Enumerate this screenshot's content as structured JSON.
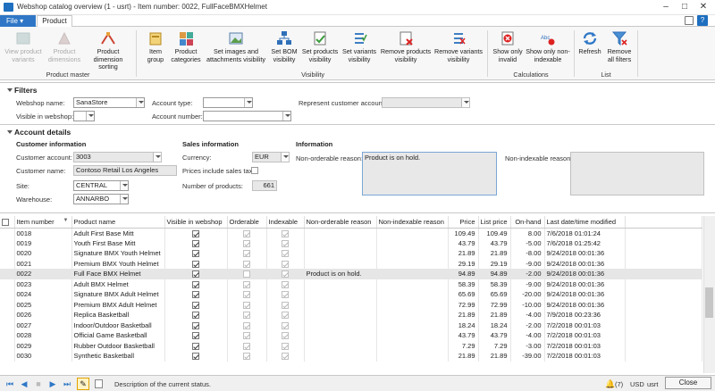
{
  "window": {
    "title": "Webshop catalog overview (1 - usrt) - Item number: 0022, FullFaceBMXHelmet"
  },
  "menu": {
    "file": "File",
    "file_arrow": "▾",
    "product_tab": "Product"
  },
  "ribbon": {
    "product_master": {
      "label": "Product master",
      "buttons": [
        "View product variants",
        "Product dimensions",
        "Product dimension sorting"
      ]
    },
    "main": {
      "buttons": [
        "Item group",
        "Product categories",
        "Set images and attachments visibility",
        "Set BOM visibility",
        "Set products visibility",
        "Set variants visibility",
        "Remove products visibility",
        "Remove variants visibility"
      ],
      "group_label": "Visibility"
    },
    "calculations": {
      "label": "Calculations",
      "buttons": [
        "Show only invalid",
        "Show only non-indexable"
      ]
    },
    "list": {
      "label": "List",
      "buttons": [
        "Refresh",
        "Remove all filters"
      ]
    }
  },
  "filters": {
    "title": "Filters",
    "webshop_name_label": "Webshop name:",
    "webshop_name": "SanaStore",
    "visible_label": "Visible in webshop:",
    "account_type_label": "Account type:",
    "account_number_label": "Account number:",
    "represent_label": "Represent customer account:"
  },
  "account": {
    "title": "Account details",
    "customer_info": "Customer information",
    "customer_account_label": "Customer account:",
    "customer_account": "3003",
    "customer_name_label": "Customer name:",
    "customer_name": "Contoso Retail Los Angeles",
    "site_label": "Site:",
    "site": "CENTRAL",
    "warehouse_label": "Warehouse:",
    "warehouse": "ANNARBO",
    "sales_info": "Sales information",
    "currency_label": "Currency:",
    "currency": "EUR",
    "prices_tax_label": "Prices include sales tax:",
    "num_products_label": "Number of products:",
    "num_products": "661",
    "information": "Information",
    "non_orderable_label": "Non-orderable reason:",
    "non_orderable": "Product is on hold.",
    "non_indexable_label": "Non-indexable reason:"
  },
  "grid": {
    "columns": [
      "Item number",
      "Product name",
      "Visible in webshop",
      "Orderable",
      "Indexable",
      "Non-orderable reason",
      "Non-indexable reason",
      "Price",
      "List price",
      "On-hand",
      "Last date/time modified"
    ],
    "sort_arrow": "▼",
    "rows": [
      {
        "item": "0018",
        "name": "Adult First Base Mitt",
        "visible": true,
        "orderable": true,
        "indexable": true,
        "reason": "",
        "price": "109.49",
        "list": "109.49",
        "onhand": "8.00",
        "date": "7/6/2018 01:01:24"
      },
      {
        "item": "0019",
        "name": "Youth First Base Mitt",
        "visible": true,
        "orderable": true,
        "indexable": true,
        "reason": "",
        "price": "43.79",
        "list": "43.79",
        "onhand": "-5.00",
        "date": "7/6/2018 01:25:42"
      },
      {
        "item": "0020",
        "name": "Signature BMX Youth Helmet",
        "visible": true,
        "orderable": true,
        "indexable": true,
        "reason": "",
        "price": "21.89",
        "list": "21.89",
        "onhand": "-8.00",
        "date": "9/24/2018 00:01:36"
      },
      {
        "item": "0021",
        "name": "Premium BMX Youth Helmet",
        "visible": true,
        "orderable": true,
        "indexable": true,
        "reason": "",
        "price": "29.19",
        "list": "29.19",
        "onhand": "-9.00",
        "date": "9/24/2018 00:01:36"
      },
      {
        "item": "0022",
        "name": "Full Face BMX Helmet",
        "visible": true,
        "orderable": false,
        "indexable": true,
        "reason": "Product is on hold.",
        "price": "94.89",
        "list": "94.89",
        "onhand": "-2.00",
        "date": "9/24/2018 00:01:36",
        "selected": true
      },
      {
        "item": "0023",
        "name": "Adult BMX Helmet",
        "visible": true,
        "orderable": true,
        "indexable": true,
        "reason": "",
        "price": "58.39",
        "list": "58.39",
        "onhand": "-9.00",
        "date": "9/24/2018 00:01:36"
      },
      {
        "item": "0024",
        "name": "Signature BMX Adult Helmet",
        "visible": true,
        "orderable": true,
        "indexable": true,
        "reason": "",
        "price": "65.69",
        "list": "65.69",
        "onhand": "-20.00",
        "date": "9/24/2018 00:01:36"
      },
      {
        "item": "0025",
        "name": "Premium BMX Adult Helmet",
        "visible": true,
        "orderable": true,
        "indexable": true,
        "reason": "",
        "price": "72.99",
        "list": "72.99",
        "onhand": "-10.00",
        "date": "9/24/2018 00:01:36"
      },
      {
        "item": "0026",
        "name": "Replica Basketball",
        "visible": true,
        "orderable": true,
        "indexable": true,
        "reason": "",
        "price": "21.89",
        "list": "21.89",
        "onhand": "-4.00",
        "date": "7/9/2018 00:23:36"
      },
      {
        "item": "0027",
        "name": "Indoor/Outdoor Basketball",
        "visible": true,
        "orderable": true,
        "indexable": true,
        "reason": "",
        "price": "18.24",
        "list": "18.24",
        "onhand": "-2.00",
        "date": "7/2/2018 00:01:03"
      },
      {
        "item": "0028",
        "name": "Official Game Basketball",
        "visible": true,
        "orderable": true,
        "indexable": true,
        "reason": "",
        "price": "43.79",
        "list": "43.79",
        "onhand": "-4.00",
        "date": "7/2/2018 00:01:03"
      },
      {
        "item": "0029",
        "name": "Rubber Outdoor Basketball",
        "visible": true,
        "orderable": true,
        "indexable": true,
        "reason": "",
        "price": "7.29",
        "list": "7.29",
        "onhand": "-3.00",
        "date": "7/2/2018 00:01:03"
      },
      {
        "item": "0030",
        "name": "Synthetic Basketball",
        "visible": true,
        "orderable": true,
        "indexable": true,
        "reason": "",
        "price": "21.89",
        "list": "21.89",
        "onhand": "-39.00",
        "date": "7/2/2018 00:01:03"
      }
    ]
  },
  "status": {
    "text": "Description of the current status.",
    "alerts": "(7)",
    "currency": "USD",
    "user": "usrt",
    "close": "Close"
  },
  "colors": {
    "accent": "#2f77c6",
    "selected_row": "#e6e6e6"
  },
  "icons": [
    "first-record-icon",
    "previous-record-icon",
    "next-record-icon",
    "last-record-icon",
    "edit-pencil-icon",
    "notes-icon",
    "bell-icon"
  ]
}
